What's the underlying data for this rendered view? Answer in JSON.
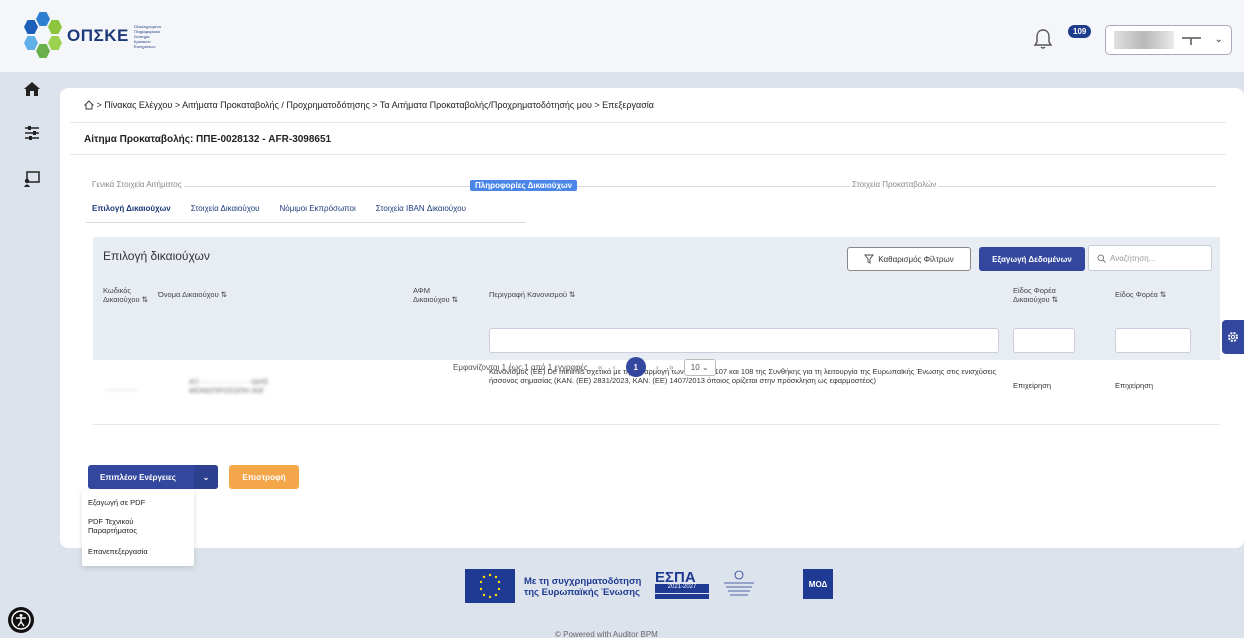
{
  "header": {
    "logo_text": "ΟΠΣΚΕ",
    "logo_subtext": "Ολοκληρωμένο Πληροφοριακό Σύστημα Κρατικών Ενισχύσεων",
    "notifications_count": "109"
  },
  "breadcrumb": {
    "text": "> Πίνακας Ελέγχου > Αιτήματα Προκαταβολής / Προχρηματοδότησης > Τα Αιτήματα Προκαταβολής/Προχρηματοδότησής μου > Επεξεργασία"
  },
  "request": {
    "title": "Αίτημα Προκαταβολής: ΠΠΕ-0028132 - AFR-3098651"
  },
  "stepper": {
    "step1": "Γενικά Στοιχεία Αιτήματος",
    "step2": "Πληροφορίες Δικαιούχων",
    "step3": "Στοιχεία Προκαταβολών"
  },
  "subtabs": {
    "tab1": "Επιλογή Δικαιούχων",
    "tab2": "Στοιχεία Δικαιούχου",
    "tab3": "Νόμιμοι Εκπρόσωποι",
    "tab4": "Στοιχεία IBAN Δικαιούχου"
  },
  "panel": {
    "title": "Επιλογή δικαιούχων",
    "filter_button": "Καθαρισμός Φίλτρων",
    "export_button": "Εξαγωγή Δεδομένων",
    "search_placeholder": "Αναζήτηση..."
  },
  "columns": {
    "code_line1": "Κωδικός",
    "code_line2": "Δικαιούχου ⇅",
    "name": "Όνομα Δικαιούχου ⇅",
    "afm_line1": "ΑΦΜ",
    "afm_line2": "Δικαιούχου ⇅",
    "regulation": "Περιγραφή Κανονισμού ⇅",
    "body_type_line1": "Είδος Φορέα",
    "body_type_line2": "Δικαιούχου ⇅",
    "org_type": "Είδος Φορέα ⇅"
  },
  "row": {
    "code": "·············",
    "name_line1": "ΑΞ·····················ΙΔΗΣ",
    "name_line2": "ΜΟΝΟΠΡΟΣΩΠΗ ΙΚΕ",
    "afm": "",
    "regulation": "Κανονισμός (ΕΕ) De minimis σχετικά με την εφαρμογή των άρθρων 107 και 108 της Συνθήκης για τη λειτουργία της Ευρωπαϊκής Ένωσης στις ενισχύσεις ήσσονος σημασίας (ΚΑΝ. (ΕΕ) 2831/2023, ΚΑΝ. (ΕΕ) 1407/2013 όποιος ορίζεται στην πρόσκληση ως εφαρμοστέος)",
    "body_type": "Επιχείρηση",
    "org_type": "Επιχείρηση"
  },
  "pagination": {
    "summary": "Εμφανίζονται 1 έως 1 από 1 εγγραφές",
    "first": "«",
    "prev": "‹",
    "current": "1",
    "next": "›",
    "last": "»",
    "page_size": "10"
  },
  "actions": {
    "more_button": "Επιπλέον Ενέργειες",
    "back_button": "Επιστροφή",
    "menu": [
      "Εξαγωγή σε PDF",
      "PDF Τεχνικού Παραρτήματος",
      "Επανεπεξεργασία"
    ]
  },
  "footer": {
    "cofund_line1": "Με τη συγχρηματοδότηση",
    "cofund_line2": "της Ευρωπαϊκής Ένωσης",
    "espa": "ΕΣΠΑ",
    "espa_years": "2021-2027",
    "mod": "ΜΟΔ",
    "powered": "© Powered with Auditor BPM"
  },
  "colors": {
    "primary": "#33479f",
    "accent_orange": "#f4a64a",
    "step_active": "#4a86e8",
    "page_bg": "#dde3ec"
  }
}
